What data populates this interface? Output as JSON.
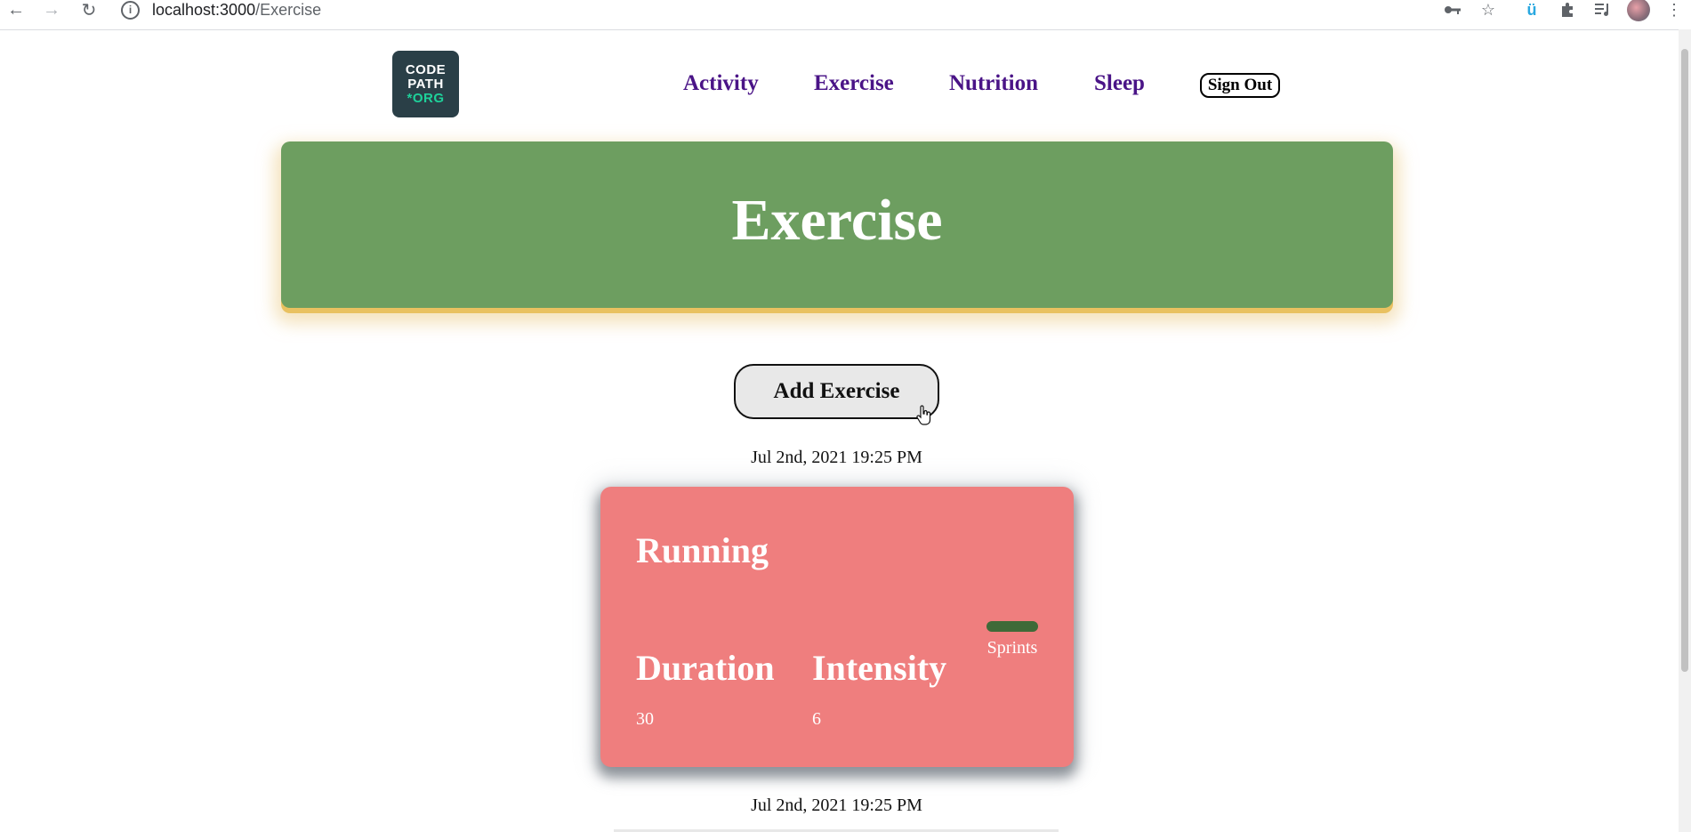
{
  "browser": {
    "url_host": "localhost:3000",
    "url_path": "/Exercise"
  },
  "logo": {
    "line1": "CODE",
    "line2": "PATH",
    "line3": "*ORG"
  },
  "nav": {
    "items": [
      {
        "label": "Activity"
      },
      {
        "label": "Exercise"
      },
      {
        "label": "Nutrition"
      },
      {
        "label": "Sleep"
      }
    ],
    "sign_out_label": "Sign Out"
  },
  "banner": {
    "title": "Exercise"
  },
  "add_button_label": "Add Exercise",
  "entries": [
    {
      "timestamp": "Jul 2nd, 2021 19:25 PM",
      "name": "Running",
      "category": "Sprints",
      "duration_label": "Duration",
      "duration_value": "30",
      "intensity_label": "Intensity",
      "intensity_value": "6"
    },
    {
      "timestamp": "Jul 2nd, 2021 19:25 PM"
    }
  ],
  "colors": {
    "nav_link": "#4a1487",
    "banner_bg": "#6d9e60",
    "banner_shadow": "#e9c160",
    "card_bg": "#ef7e7e",
    "tag_bar": "#3f6a38",
    "logo_bg": "#2a3f47",
    "logo_accent": "#1ed19a"
  }
}
